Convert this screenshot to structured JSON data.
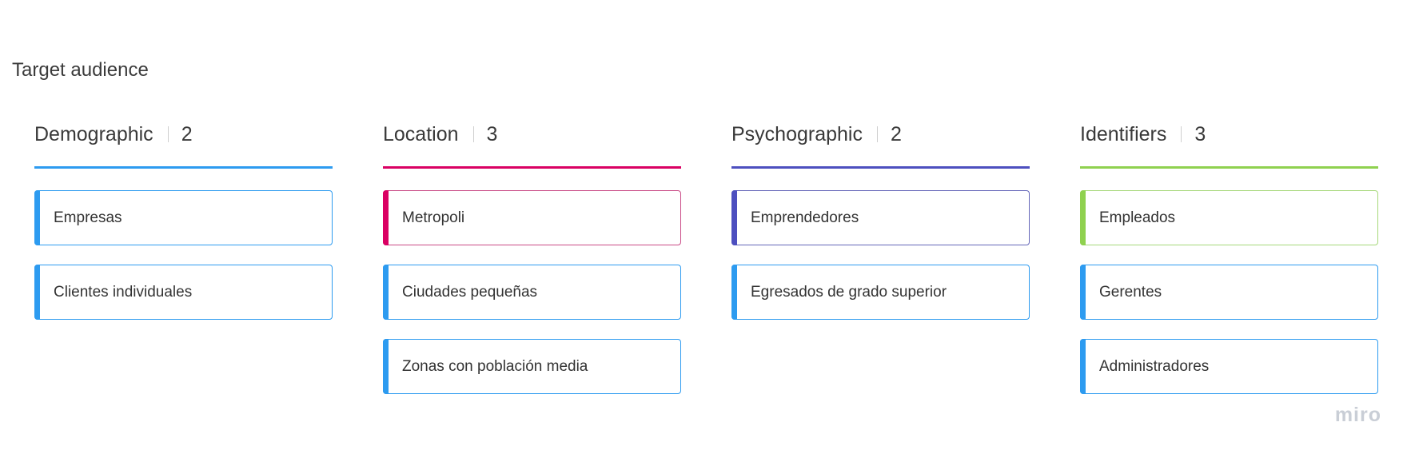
{
  "board": {
    "title": "Target audience"
  },
  "columns": [
    {
      "title": "Demographic",
      "count": "2",
      "color": "#2d9bf0",
      "cards": [
        {
          "label": "Empresas",
          "accent": "#2d9bf0",
          "border": "#2d9bf0"
        },
        {
          "label": "Clientes individuales",
          "accent": "#2d9bf0",
          "border": "#2d9bf0"
        }
      ]
    },
    {
      "title": "Location",
      "count": "3",
      "color": "#da0063",
      "cards": [
        {
          "label": "Metropoli",
          "accent": "#da0063",
          "border": "#c94a86"
        },
        {
          "label": "Ciudades pequeñas",
          "accent": "#2d9bf0",
          "border": "#2d9bf0"
        },
        {
          "label": "Zonas con población media",
          "accent": "#2d9bf0",
          "border": "#2d9bf0"
        }
      ]
    },
    {
      "title": "Psychographic",
      "count": "2",
      "color": "#4d4fbf",
      "cards": [
        {
          "label": "Emprendedores",
          "accent": "#4d4fbf",
          "border": "#6466b8"
        },
        {
          "label": "Egresados de grado superior",
          "accent": "#2d9bf0",
          "border": "#2d9bf0"
        }
      ]
    },
    {
      "title": "Identifiers",
      "count": "3",
      "color": "#8fd14f",
      "cards": [
        {
          "label": "Empleados",
          "accent": "#8fd14f",
          "border": "#a6d87a"
        },
        {
          "label": "Gerentes",
          "accent": "#2d9bf0",
          "border": "#2d9bf0"
        },
        {
          "label": "Administradores",
          "accent": "#2d9bf0",
          "border": "#2d9bf0"
        }
      ]
    }
  ],
  "watermark": {
    "text": "miro"
  }
}
